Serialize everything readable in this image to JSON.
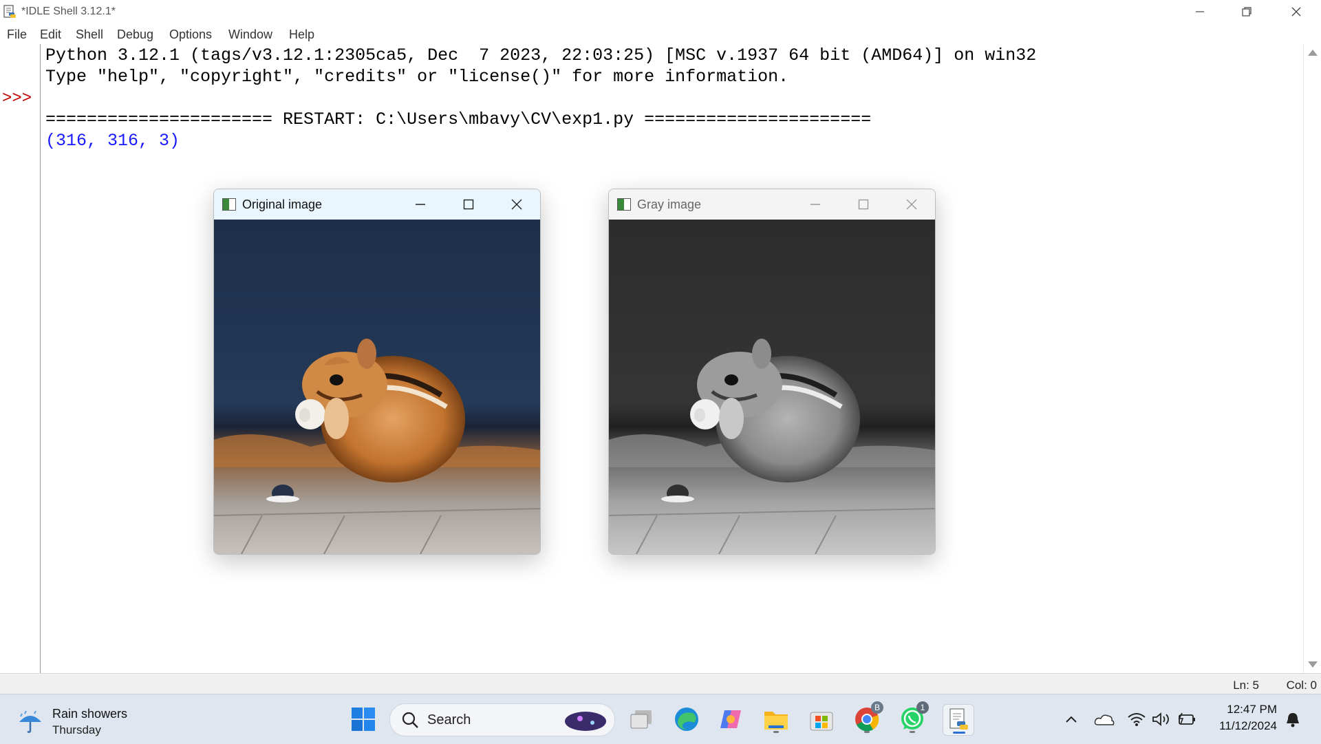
{
  "window": {
    "title": "*IDLE Shell 3.12.1*"
  },
  "menu": [
    "File",
    "Edit",
    "Shell",
    "Debug",
    "Options",
    "Window",
    "Help"
  ],
  "shell": {
    "prompt": ">>>",
    "lines": [
      "Python 3.12.1 (tags/v3.12.1:2305ca5, Dec  7 2023, 22:03:25) [MSC v.1937 64 bit (AMD64)] on win32",
      "Type \"help\", \"copyright\", \"credits\" or \"license()\" for more information.",
      "====================== RESTART: C:\\Users\\mbavy\\CV\\exp1.py ======================",
      "(316, 316, 3)"
    ]
  },
  "status": {
    "line": "Ln: 5",
    "column": "Col: 0"
  },
  "image_windows": [
    {
      "title": "Original image",
      "state": "active",
      "content": "color photo of a chipmunk eating"
    },
    {
      "title": "Gray image",
      "state": "inactive",
      "content": "grayscale photo of a chipmunk eating"
    }
  ],
  "taskbar": {
    "weather": {
      "condition": "Rain showers",
      "day": "Thursday"
    },
    "search_label": "Search",
    "pinned_apps": [
      "start",
      "search",
      "task-view",
      "edge",
      "copilot",
      "file-explorer",
      "microsoft-store",
      "chrome",
      "whatsapp",
      "idle"
    ],
    "chrome_badge": "B",
    "whatsapp_badge": "1",
    "clock": {
      "time": "12:47 PM",
      "date": "11/12/2024"
    }
  },
  "colors": {
    "prompt": "#c00000",
    "output": "#1a1aff",
    "taskbar": "#dfe6ef"
  }
}
